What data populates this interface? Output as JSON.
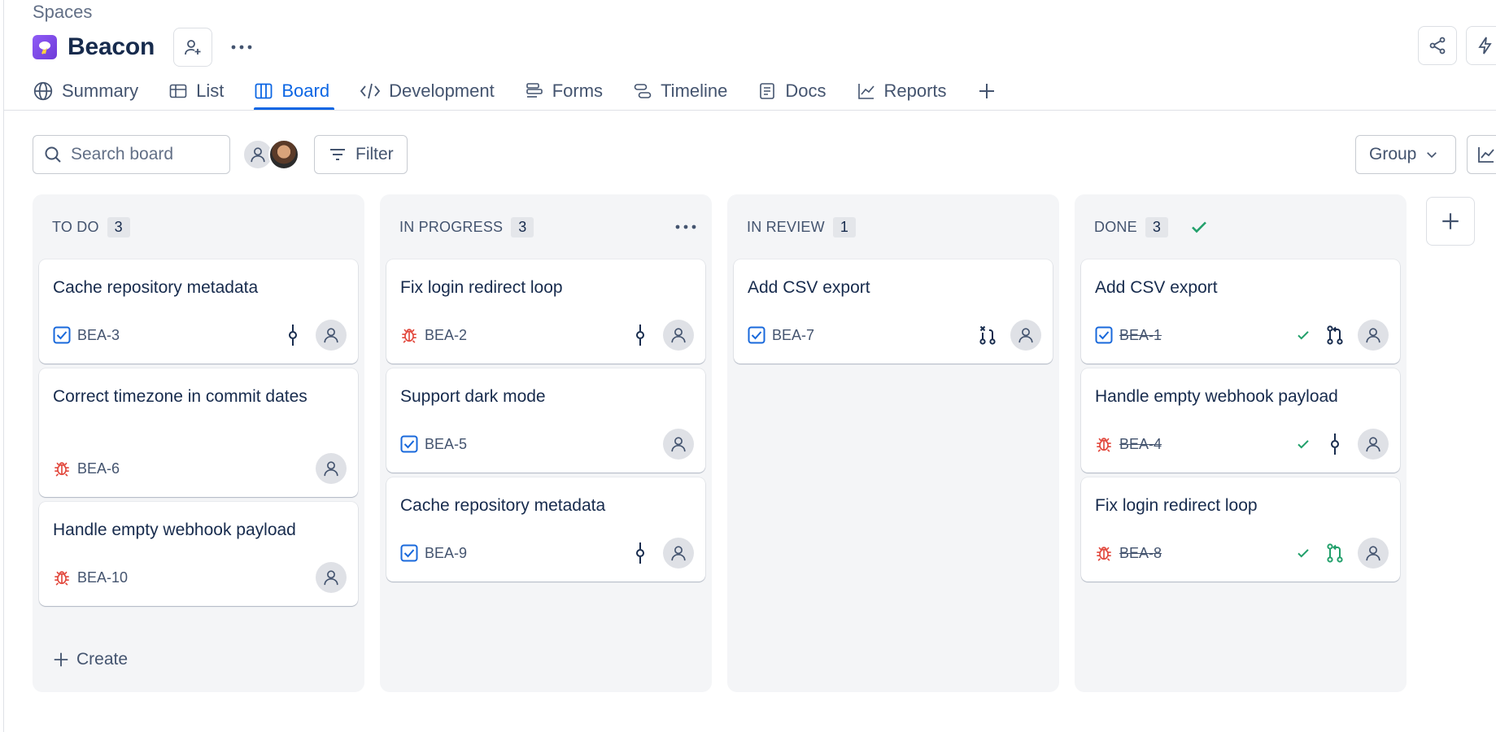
{
  "breadcrumb": "Spaces",
  "space": {
    "title": "Beacon"
  },
  "tabs": [
    {
      "label": "Summary",
      "icon": "globe-icon"
    },
    {
      "label": "List",
      "icon": "table-icon"
    },
    {
      "label": "Board",
      "icon": "board-icon",
      "active": true
    },
    {
      "label": "Development",
      "icon": "code-icon"
    },
    {
      "label": "Forms",
      "icon": "forms-icon"
    },
    {
      "label": "Timeline",
      "icon": "timeline-icon"
    },
    {
      "label": "Docs",
      "icon": "document-icon"
    },
    {
      "label": "Reports",
      "icon": "chart-icon"
    }
  ],
  "toolbar": {
    "search_placeholder": "Search board",
    "filter_label": "Filter",
    "group_label": "Group"
  },
  "colors": {
    "accent": "#0c66e4",
    "bug": "#e2483d",
    "task": "#1868db",
    "done": "#22a06b"
  },
  "columns": [
    {
      "name": "TO DO",
      "count": "3",
      "cards": [
        {
          "title": "Cache repository metadata",
          "key": "BEA-3",
          "type": "task",
          "dev": "commit-icon"
        },
        {
          "title": "Correct timezone in commit dates",
          "key": "BEA-6",
          "type": "bug",
          "dev": ""
        },
        {
          "title": "Handle empty webhook payload",
          "key": "BEA-10",
          "type": "bug",
          "dev": ""
        }
      ],
      "create_label": "Create"
    },
    {
      "name": "IN PROGRESS",
      "count": "3",
      "cards": [
        {
          "title": "Fix login redirect loop",
          "key": "BEA-2",
          "type": "bug",
          "dev": "commit-icon"
        },
        {
          "title": "Support dark mode",
          "key": "BEA-5",
          "type": "task",
          "dev": ""
        },
        {
          "title": "Cache repository metadata",
          "key": "BEA-9",
          "type": "task",
          "dev": "commit-icon"
        }
      ]
    },
    {
      "name": "IN REVIEW",
      "count": "1",
      "cards": [
        {
          "title": "Add CSV export",
          "key": "BEA-7",
          "type": "task",
          "dev": "pull-request-declined-icon"
        }
      ]
    },
    {
      "name": "DONE",
      "count": "3",
      "cards": [
        {
          "title": "Add CSV export",
          "key": "BEA-1",
          "type": "task",
          "dev": "pull-request-icon"
        },
        {
          "title": "Handle empty webhook payload",
          "key": "BEA-4",
          "type": "bug",
          "dev": "commit-icon"
        },
        {
          "title": "Fix login redirect loop",
          "key": "BEA-8",
          "type": "bug",
          "dev": "pull-request-merged-icon"
        }
      ]
    }
  ]
}
